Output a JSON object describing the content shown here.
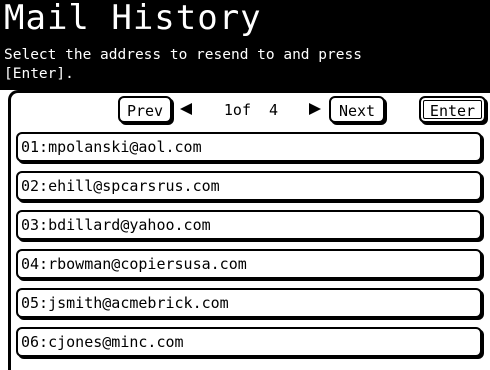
{
  "header": {
    "title": "Mail History",
    "instruction": "Select the address to resend to and press\n[Enter]."
  },
  "nav": {
    "prev_label": "Prev",
    "next_label": "Next",
    "enter_label": "Enter",
    "page_indicator": "1of  4"
  },
  "addresses": [
    {
      "label": "01:mpolanski@aol.com"
    },
    {
      "label": "02:ehill@spcarsrus.com"
    },
    {
      "label": "03:bdillard@yahoo.com"
    },
    {
      "label": "04:rbowman@copiersusa.com"
    },
    {
      "label": "05:jsmith@acmebrick.com"
    },
    {
      "label": "06:cjones@minc.com"
    }
  ],
  "colors": {
    "header_bg": "#000000",
    "header_fg": "#ffffff",
    "panel_bg": "#ffffff",
    "border": "#000000"
  }
}
